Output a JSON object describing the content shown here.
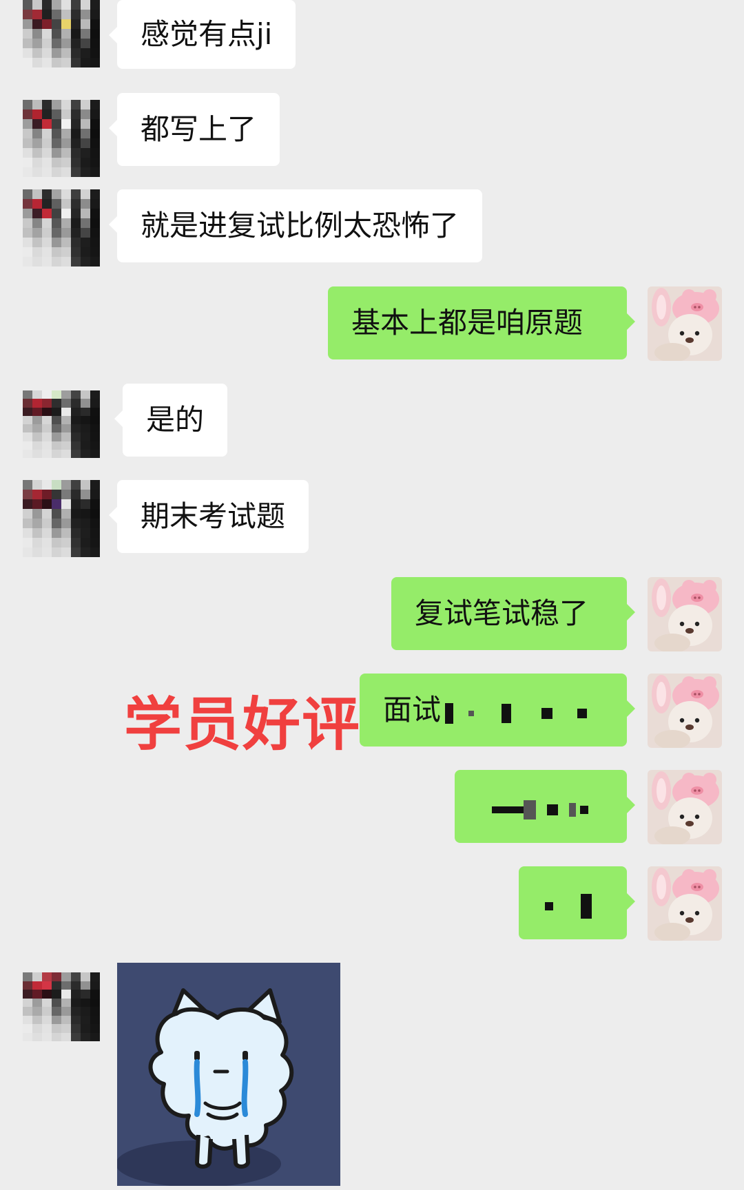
{
  "messages": [
    {
      "side": "in",
      "text": "感觉有点ji"
    },
    {
      "side": "in",
      "text": "都写上了"
    },
    {
      "side": "in",
      "text": "就是进复试比例太恐怖了"
    },
    {
      "side": "out",
      "text": "基本上都是咱原题"
    },
    {
      "side": "in",
      "text": "是的"
    },
    {
      "side": "in",
      "text": "期末考试题"
    },
    {
      "side": "out",
      "text": "复试笔试稳了"
    },
    {
      "side": "out",
      "text": "面试"
    },
    {
      "side": "out",
      "text": ""
    },
    {
      "side": "out",
      "text": ""
    },
    {
      "side": "in",
      "type": "sticker",
      "sticker": "crying-cat-sticker"
    }
  ],
  "overlay": {
    "label": "学员好评",
    "color": "#f0403f"
  },
  "colors": {
    "background": "#ededed",
    "incoming_bubble": "#ffffff",
    "outgoing_bubble": "#95ec69",
    "sticker_background": "#3e4a70"
  }
}
